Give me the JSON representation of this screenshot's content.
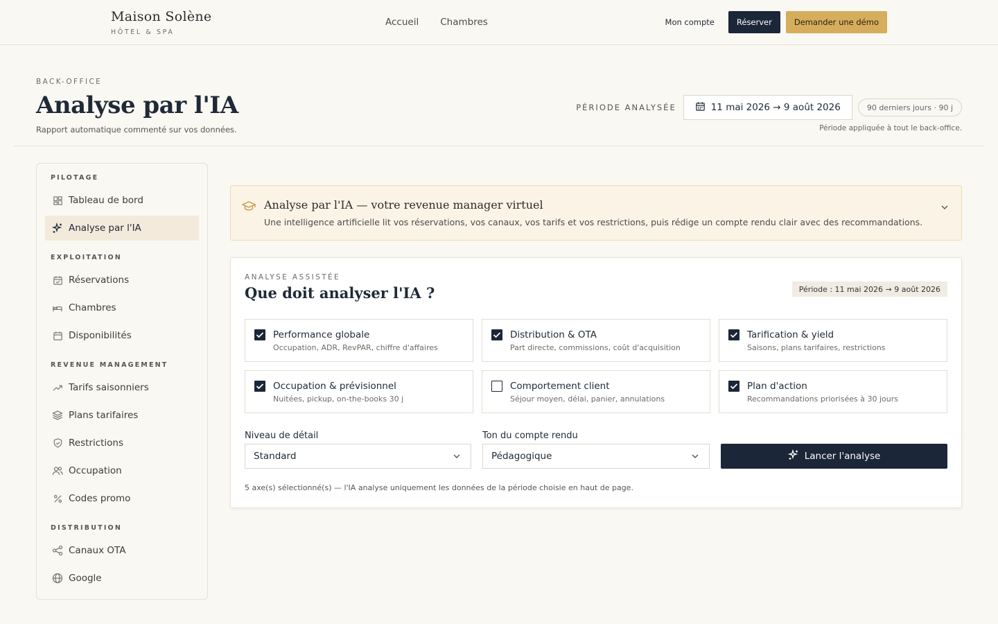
{
  "brand": {
    "name": "Maison Solène",
    "sub": "HÔTEL & SPA"
  },
  "nav": {
    "links": [
      "Accueil",
      "Chambres"
    ],
    "account": "Mon compte",
    "book": "Réserver",
    "demo": "Demander une démo"
  },
  "header": {
    "eyebrow": "BACK-OFFICE",
    "title": "Analyse par l'IA",
    "subtitle": "Rapport automatique commenté sur vos données.",
    "period_label": "PÉRIODE ANALYSÉE",
    "period_value": "11 mai 2026 → 9 août 2026",
    "period_pill": "90 derniers jours · 90 j",
    "period_note": "Période appliquée à tout le back-office."
  },
  "sidebar": {
    "sections": [
      {
        "title": "PILOTAGE",
        "items": [
          {
            "label": "Tableau de bord",
            "icon": "grid-icon"
          },
          {
            "label": "Analyse par l'IA",
            "icon": "sparkles-icon",
            "active": true
          }
        ]
      },
      {
        "title": "EXPLOITATION",
        "items": [
          {
            "label": "Réservations",
            "icon": "calendar-check-icon"
          },
          {
            "label": "Chambres",
            "icon": "bed-icon"
          },
          {
            "label": "Disponibilités",
            "icon": "calendar-icon"
          }
        ]
      },
      {
        "title": "REVENUE MANAGEMENT",
        "items": [
          {
            "label": "Tarifs saisonniers",
            "icon": "trend-up-icon"
          },
          {
            "label": "Plans tarifaires",
            "icon": "layers-icon"
          },
          {
            "label": "Restrictions",
            "icon": "shield-icon"
          },
          {
            "label": "Occupation",
            "icon": "users-icon"
          },
          {
            "label": "Codes promo",
            "icon": "percent-icon"
          }
        ]
      },
      {
        "title": "DISTRIBUTION",
        "items": [
          {
            "label": "Canaux OTA",
            "icon": "share-icon"
          },
          {
            "label": "Google",
            "icon": "globe-icon"
          }
        ]
      }
    ]
  },
  "banner": {
    "title": "Analyse par l'IA — votre revenue manager virtuel",
    "desc": "Une intelligence artificielle lit vos réservations, vos canaux, vos tarifs et vos restrictions, puis rédige un compte rendu clair avec des recommandations."
  },
  "analysis": {
    "eyebrow": "ANALYSE ASSISTÉE",
    "title": "Que doit analyser l'IA ?",
    "period": "Période : 11 mai 2026 → 9 août 2026",
    "axes": [
      {
        "title": "Performance globale",
        "desc": "Occupation, ADR, RevPAR, chiffre d'affaires",
        "checked": true
      },
      {
        "title": "Distribution & OTA",
        "desc": "Part directe, commissions, coût d'acquisition",
        "checked": true
      },
      {
        "title": "Tarification & yield",
        "desc": "Saisons, plans tarifaires, restrictions",
        "checked": true
      },
      {
        "title": "Occupation & prévisionnel",
        "desc": "Nuitées, pickup, on-the-books 30 j",
        "checked": true
      },
      {
        "title": "Comportement client",
        "desc": "Séjour moyen, délai, panier, annulations",
        "checked": false
      },
      {
        "title": "Plan d'action",
        "desc": "Recommandations priorisées à 30 jours",
        "checked": true
      }
    ],
    "detail_label": "Niveau de détail",
    "detail_value": "Standard",
    "tone_label": "Ton du compte rendu",
    "tone_value": "Pédagogique",
    "run_label": "Lancer l'analyse",
    "footnote": "5 axe(s) sélectionné(s) — l'IA analyse uniquement les données de la période choisie en haut de page."
  },
  "colors": {
    "navy": "#1b2638",
    "gold": "#d6ad5c",
    "background": "#faf8f3"
  }
}
